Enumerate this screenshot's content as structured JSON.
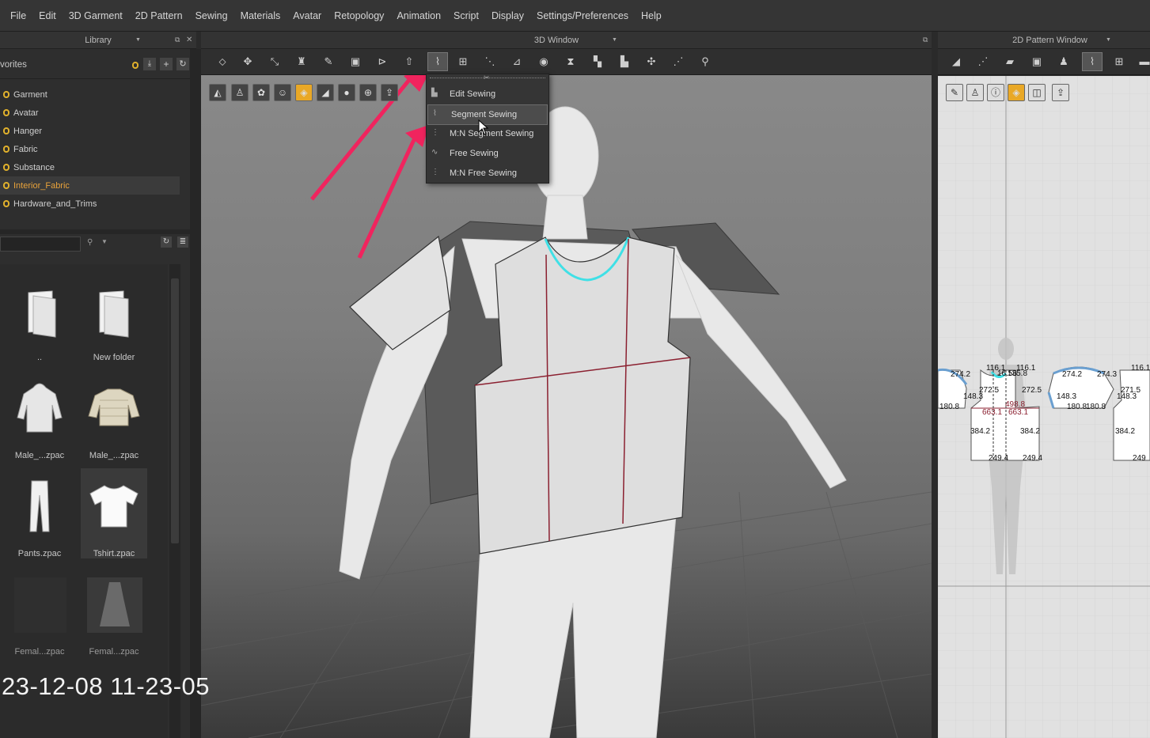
{
  "menubar": {
    "items": [
      "File",
      "Edit",
      "3D Garment",
      "2D Pattern",
      "Sewing",
      "Materials",
      "Avatar",
      "Retopology",
      "Animation",
      "Script",
      "Display",
      "Settings/Preferences",
      "Help"
    ]
  },
  "library": {
    "title": "Library",
    "favorites_label": "vorites",
    "favorites": [
      "Garment",
      "Avatar",
      "Hanger",
      "Fabric",
      "Substance",
      "Interior_Fabric",
      "Hardware_and_Trims"
    ],
    "selected_favorite": "Interior_Fabric",
    "files": [
      {
        "label": "..",
        "icon": "folder-icon"
      },
      {
        "label": "New folder",
        "icon": "folder-icon"
      },
      {
        "label": "Male_...zpac",
        "icon": "hoodie-icon"
      },
      {
        "label": "Male_...zpac",
        "icon": "jacket-icon"
      },
      {
        "label": "Pants.zpac",
        "icon": "pants-icon"
      },
      {
        "label": "Tshirt.zpac",
        "icon": "tshirt-icon"
      },
      {
        "label": "Femal...zpac",
        "icon": "dress-icon"
      },
      {
        "label": "Femal...zpac",
        "icon": "dress-icon"
      }
    ],
    "selected_file": "Tshirt.zpac"
  },
  "overlay_timestamp": "23-12-08 11-23-05",
  "view3d": {
    "title": "3D Window"
  },
  "sewing_menu": {
    "items": [
      "Edit Sewing",
      "Segment Sewing",
      "M:N Segment Sewing",
      "Free Sewing",
      "M:N Free Sewing"
    ],
    "highlighted": "Segment Sewing"
  },
  "pattern_window": {
    "title": "2D Pattern Window",
    "measurements": {
      "top_left": "274.2",
      "top_1": "116.1",
      "top_2": "116.1",
      "top_mid": "16.56",
      "top_mid2": "135.8",
      "top_right1": "274.2",
      "top_right2": "274.3",
      "top_right3": "116.1",
      "m1": "272.5",
      "m2": "272.5",
      "m3": "271.5",
      "s1": "148.3",
      "s2": "148.3",
      "s3": "148.3",
      "b1": "180.8",
      "b2": "180.8",
      "b3": "180.8",
      "red1": "498.8",
      "red2": "663.1",
      "red3": "663.1",
      "side1": "384.2",
      "side2": "384.2",
      "side3": "384.2",
      "bottom1": "249.4",
      "bottom2": "249.4",
      "bottom3": "249"
    }
  },
  "colors": {
    "accent_orange": "#e8a23a",
    "annotation_arrow": "#f0245e",
    "highlight_cyan": "#3fe0e6"
  }
}
